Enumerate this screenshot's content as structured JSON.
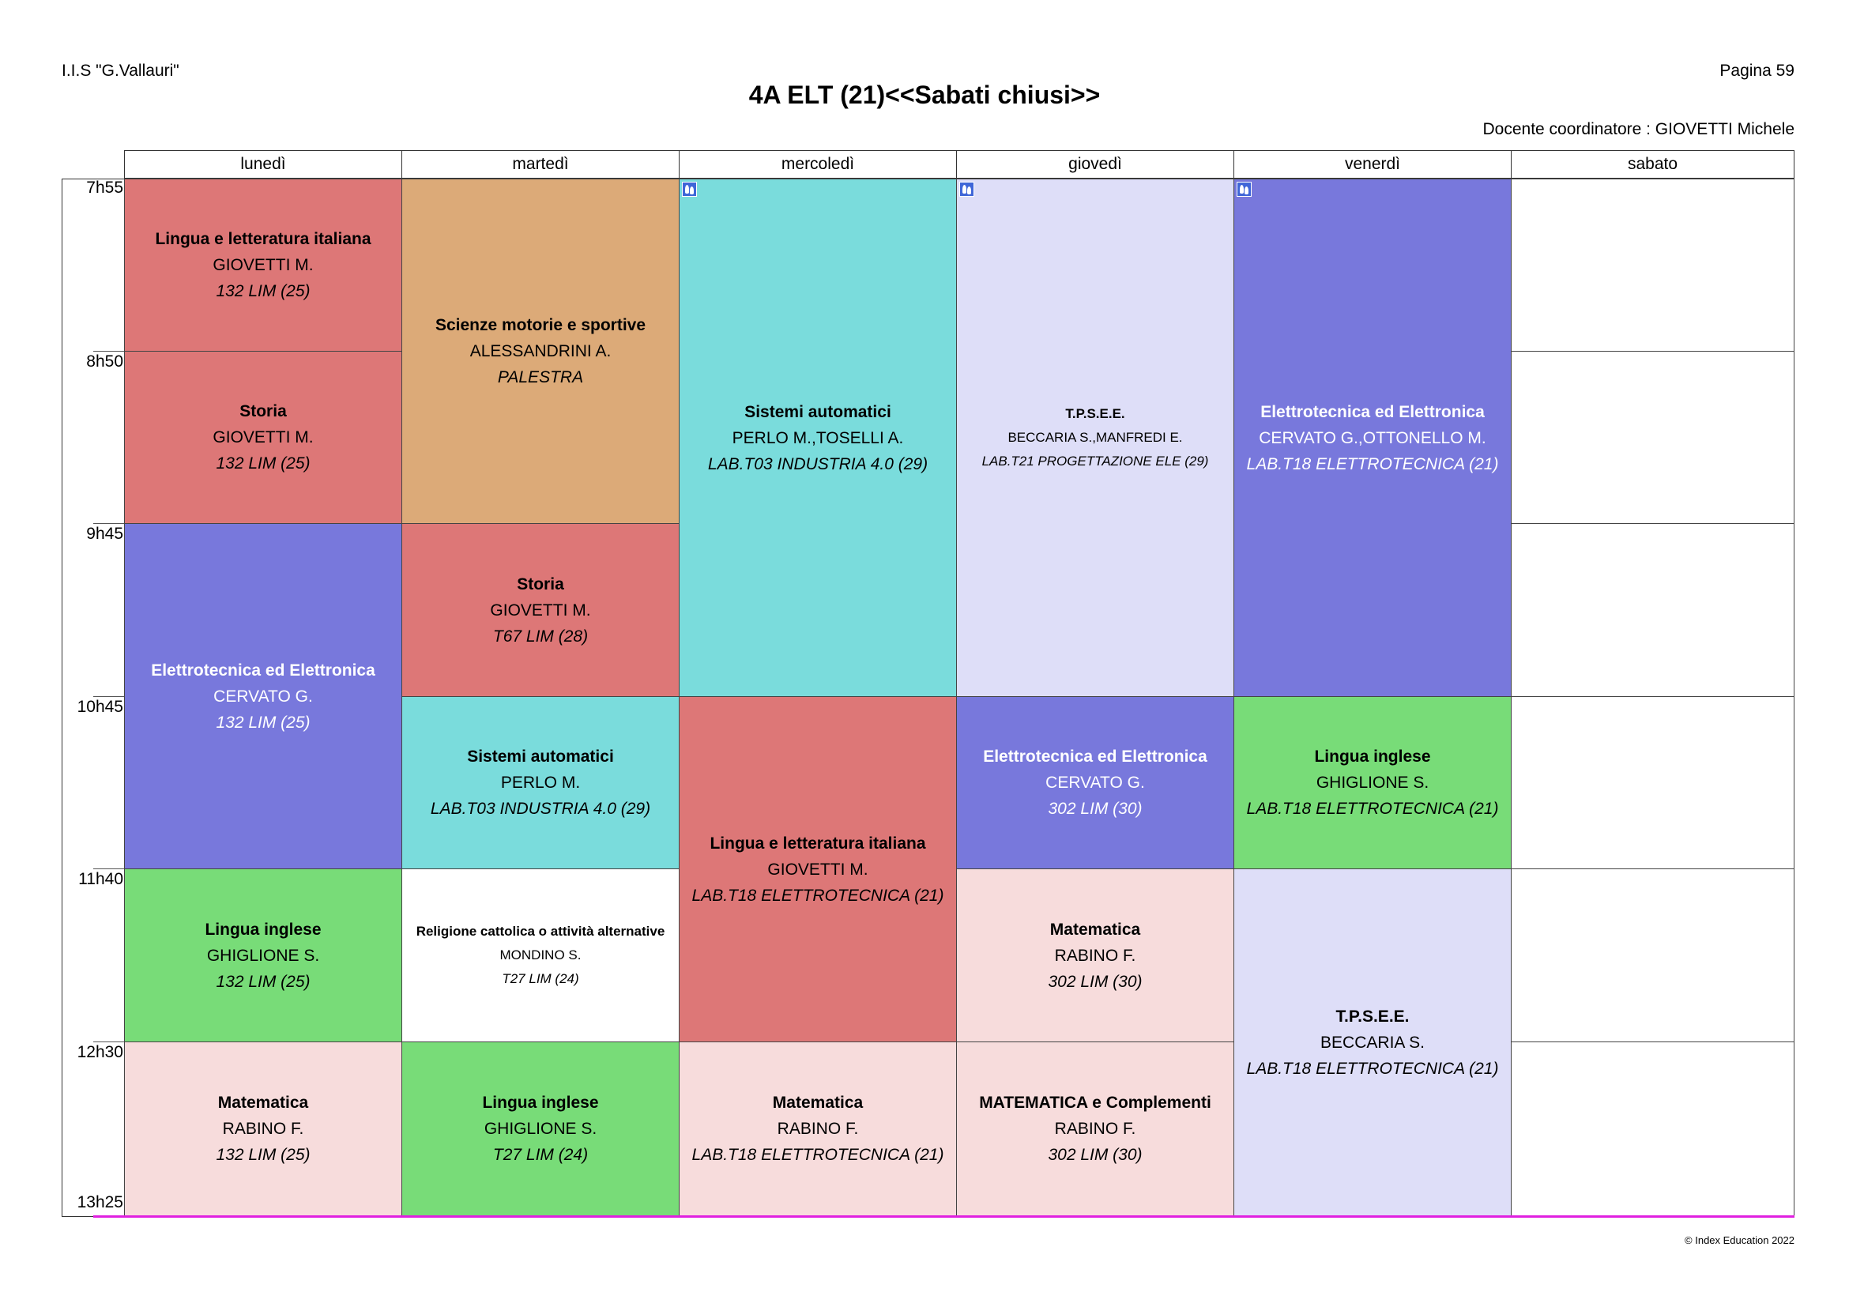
{
  "header": {
    "school": "I.I.S \"G.Vallauri\"",
    "page": "Pagina 59",
    "title": "4A ELT (21)<<Sabati chiusi>>",
    "coordinator": "Docente coordinatore : GIOVETTI Michele"
  },
  "days": [
    "lunedì",
    "martedì",
    "mercoledì",
    "giovedì",
    "venerdì",
    "sabato"
  ],
  "times": [
    "7h55",
    "8h50",
    "9h45",
    "10h45",
    "11h40",
    "12h30",
    "13h25"
  ],
  "colors": {
    "red": "#dd7777",
    "orange": "#dcaa78",
    "cyan": "#7adcdc",
    "lavender": "#dedef8",
    "blue": "#7878dc",
    "green": "#78dc78",
    "pink": "#f7dcdc",
    "white": "#ffffff"
  },
  "lessons": {
    "mon_1": {
      "subject": "Lingua e letteratura italiana",
      "teacher": "GIOVETTI M.",
      "room": "132 LIM (25)"
    },
    "mon_2": {
      "subject": "Storia",
      "teacher": "GIOVETTI M.",
      "room": "132 LIM (25)"
    },
    "mon_3": {
      "subject": "Elettrotecnica ed Elettronica",
      "teacher": "CERVATO G.",
      "room": "132 LIM (25)"
    },
    "mon_5": {
      "subject": "Lingua inglese",
      "teacher": "GHIGLIONE S.",
      "room": "132 LIM (25)"
    },
    "mon_6": {
      "subject": "Matematica",
      "teacher": "RABINO F.",
      "room": "132 LIM (25)"
    },
    "tue_1": {
      "subject": "Scienze motorie e sportive",
      "teacher": "ALESSANDRINI A.",
      "room": "PALESTRA"
    },
    "tue_3": {
      "subject": "Storia",
      "teacher": "GIOVETTI M.",
      "room": "T67 LIM (28)"
    },
    "tue_4": {
      "subject": "Sistemi automatici",
      "teacher": "PERLO M.",
      "room": "LAB.T03 INDUSTRIA 4.0 (29)"
    },
    "tue_5": {
      "subject": "Religione cattolica o attività alternative",
      "teacher": "MONDINO S.",
      "room": "T27 LIM (24)"
    },
    "tue_6": {
      "subject": "Lingua inglese",
      "teacher": "GHIGLIONE S.",
      "room": "T27 LIM (24)"
    },
    "wed_1": {
      "subject": "Sistemi automatici",
      "teacher": "PERLO M.,TOSELLI A.",
      "room": "LAB.T03 INDUSTRIA 4.0 (29)"
    },
    "wed_4": {
      "subject": "Lingua e letteratura italiana",
      "teacher": "GIOVETTI M.",
      "room": "LAB.T18 ELETTROTECNICA  (21)"
    },
    "wed_6": {
      "subject": "Matematica",
      "teacher": "RABINO F.",
      "room": "LAB.T18 ELETTROTECNICA  (21)"
    },
    "thu_1": {
      "subject": "T.P.S.E.E.",
      "teacher": "BECCARIA S.,MANFREDI E.",
      "room": "LAB.T21 PROGETTAZIONE ELE (29)"
    },
    "thu_4": {
      "subject": "Elettrotecnica ed Elettronica",
      "teacher": "CERVATO G.",
      "room": "302 LIM (30)"
    },
    "thu_5": {
      "subject": "Matematica",
      "teacher": "RABINO F.",
      "room": "302 LIM (30)"
    },
    "thu_6": {
      "subject": "MATEMATICA e Complementi",
      "teacher": "RABINO F.",
      "room": "302 LIM (30)"
    },
    "fri_1": {
      "subject": "Elettrotecnica ed Elettronica",
      "teacher": "CERVATO G.,OTTONELLO M.",
      "room": "LAB.T18 ELETTROTECNICA  (21)"
    },
    "fri_4": {
      "subject": "Lingua inglese",
      "teacher": "GHIGLIONE S.",
      "room": "LAB.T18 ELETTROTECNICA  (21)"
    },
    "fri_5": {
      "subject": "T.P.S.E.E.",
      "teacher": "BECCARIA S.",
      "room": "LAB.T18 ELETTROTECNICA  (21)"
    }
  },
  "footer": "© Index Education 2022"
}
